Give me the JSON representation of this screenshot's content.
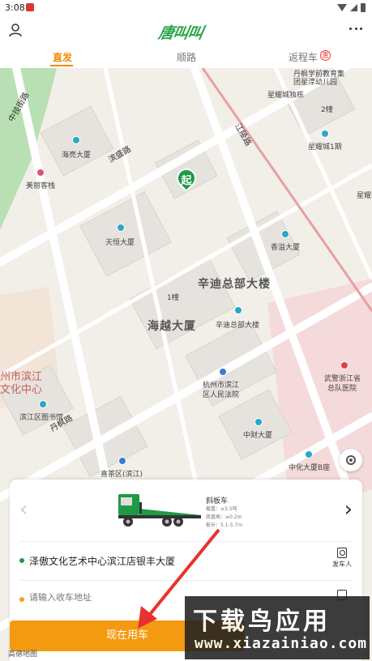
{
  "status_bar": {
    "time": "3:08"
  },
  "header": {
    "logo": "唐叫叫",
    "tabs": [
      {
        "label": "直发",
        "active": true
      },
      {
        "label": "顺路",
        "active": false
      },
      {
        "label": "返程车",
        "active": false,
        "badge": "惠"
      }
    ]
  },
  "map": {
    "start_pin": "起",
    "roads": [
      "中技街路",
      "滨盛路",
      "江陵路",
      "丹枫路",
      "运河路"
    ],
    "labels": {
      "haike": "海亮大厦",
      "meili": "美丽客栈",
      "tianheng": "天恒大厦",
      "xiangyi": "香溢大厦",
      "xindi_big": "辛迪总部大楼",
      "xindi_small": "辛迪总部大楼",
      "haiyue": "海越大厦",
      "building1": "1幢",
      "court1": "杭州市滨江",
      "court2": "区人民法院",
      "wujing1": "武警浙江省",
      "wujing2": "总队医院",
      "zhongcai": "中财大厦",
      "zhonghua": "中化大厦B座",
      "library": "滨江区图书馆",
      "culture1": "州市滨江",
      "culture2": "文化中心",
      "xingyao": "星耀城1期",
      "xingyaoshop": "星耀城独栋",
      "school1": "丹枫学前教育集",
      "school2": "团星淳幼儿园",
      "building2": "2幢",
      "xingshi": "星耀城",
      "fangmu": "喜茶区(滨江)"
    },
    "attribution": "高德地图"
  },
  "panel": {
    "vehicle_name": "斜板车",
    "specs": [
      "载重：≤3.5吨",
      "底盘高：≥0.2m",
      "板长：5.1-5.7m"
    ],
    "start_address": "泽傲文化艺术中心滨江店银丰大厦",
    "dest_placeholder": "请输入收车地址",
    "sender_label": "发车人",
    "cta_label": "现在用车"
  },
  "watermark": {
    "main": "下载鸟应用",
    "sub": "www.xiazainiao.com"
  },
  "colors": {
    "accent": "#f39a10",
    "brand_green": "#2aa64a",
    "pin_green": "#1e9a45"
  }
}
